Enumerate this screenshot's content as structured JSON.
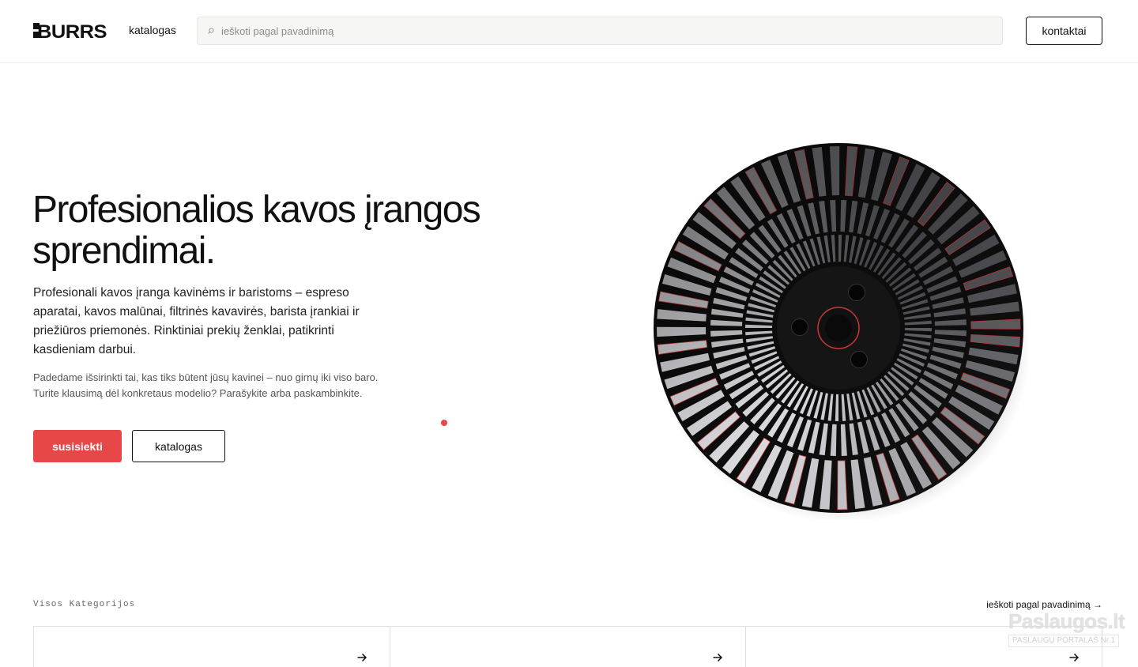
{
  "header": {
    "logo_text": "BURRS",
    "nav_catalog": "katalogas",
    "search_placeholder": "ieškoti pagal pavadinimą",
    "contacts_label": "kontaktai"
  },
  "hero": {
    "title": "Profesionalios kavos įrangos sprendimai.",
    "lead": "Profesionali kavos įranga kavinėms ir baristoms – espreso aparatai, kavos malūnai, filtrinės kavavirės, barista įrankiai ir priežiūros priemonės. Rinktiniai prekių ženklai, patikrinti kasdieniam darbui.",
    "sub_line1": "Padedame išsirinkti tai, kas tiks būtent jūsų kavinei – nuo girnų iki viso baro.",
    "sub_line2": "Turite klausimą dėl konkretaus modelio? Parašykite arba paskambinkite.",
    "primary_button": "susisiekti",
    "secondary_button": "katalogas"
  },
  "categories": {
    "label": "Visos Kategorijos",
    "search_link": "ieškoti pagal pavadinimą →",
    "cards": [
      {
        "icon": "arrow-right-icon"
      },
      {
        "icon": "arrow-right-icon"
      },
      {
        "icon": "arrow-right-icon"
      }
    ]
  },
  "watermark": {
    "top": "Paslaugos.lt",
    "bottom": "PASLAUGŲ PORTALAS Nr.1"
  },
  "colors": {
    "accent": "#e84747",
    "text": "#111111",
    "search_bg": "#f6f6f4"
  }
}
